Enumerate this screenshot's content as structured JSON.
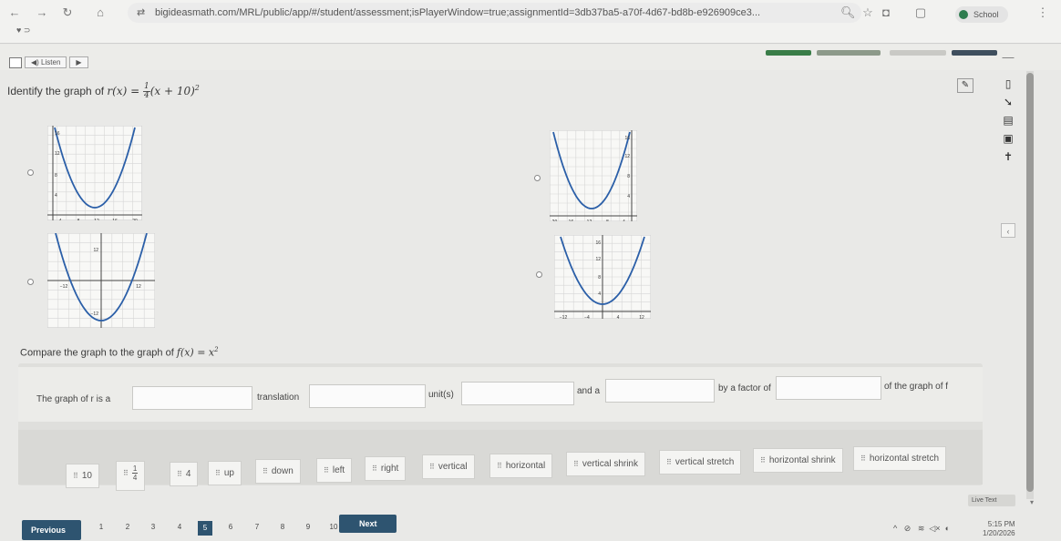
{
  "browser": {
    "url": "bigideasmath.com/MRL/public/app/#/student/assessment;isPlayerWindow=true;assignmentId=3db37ba5-a70f-4d67-bd8b-e926909ce3...",
    "profile_label": "School"
  },
  "toolbar": {
    "tts_label": "◀) Listen",
    "colors": [
      "#3a7d48",
      "#8d9a8a",
      "#c9c9c5",
      "#3f4f5e",
      "#3f4f5e"
    ]
  },
  "question": {
    "prefix": "Identify the graph of ",
    "func_name": "r(x) = ",
    "frac_num": "1",
    "frac_den": "4",
    "func_rest": "(x + 10)",
    "exponent": "2"
  },
  "graphs": [
    {
      "name": "top-left",
      "shift": 10,
      "ticks_x": [
        "4",
        "8",
        "12",
        "16",
        "20"
      ],
      "ticks_y": [
        "16",
        "12",
        "8",
        "4"
      ]
    },
    {
      "name": "top-right",
      "shift": -10,
      "ticks_x": [
        "−20",
        "−16",
        "−12",
        "−8",
        "−4"
      ],
      "ticks_y": [
        "16",
        "12",
        "8",
        "4"
      ]
    },
    {
      "name": "bottom-left",
      "shift": 0,
      "ticks_x": [
        "−12",
        "12"
      ],
      "ticks_y": [
        "12",
        "−12"
      ]
    },
    {
      "name": "bottom-right",
      "shift": 0,
      "ticks_x": [
        "−12",
        "−4",
        "4",
        "12"
      ],
      "ticks_y": [
        "16",
        "12",
        "8",
        "4"
      ]
    }
  ],
  "compare": {
    "text": "Compare the graph to the graph of ",
    "func": "f(x) = x",
    "exponent": "2"
  },
  "sentence": {
    "part1": "The graph of r is a",
    "part2": "translation",
    "part3": "unit(s)",
    "part4": "and a",
    "part5": "by a factor of",
    "part6": "of the graph of f"
  },
  "tiles": [
    {
      "label": "10"
    },
    {
      "label_num": "1",
      "label_den": "4"
    },
    {
      "label": "4"
    },
    {
      "label": "up"
    },
    {
      "label": "down"
    },
    {
      "label": "left"
    },
    {
      "label": "right"
    },
    {
      "label": "vertical"
    },
    {
      "label": "horizontal"
    },
    {
      "label": "vertical shrink"
    },
    {
      "label": "vertical stretch"
    },
    {
      "label": "horizontal shrink"
    },
    {
      "label": "horizontal stretch"
    }
  ],
  "footer": {
    "previous": "Previous",
    "next": "Next",
    "pages": [
      "1",
      "2",
      "3",
      "4",
      "5",
      "6",
      "7",
      "8",
      "9",
      "10"
    ],
    "current_page": 5,
    "live_text": "Live Text",
    "time": "5:15 PM",
    "date": "1/20/2026"
  }
}
